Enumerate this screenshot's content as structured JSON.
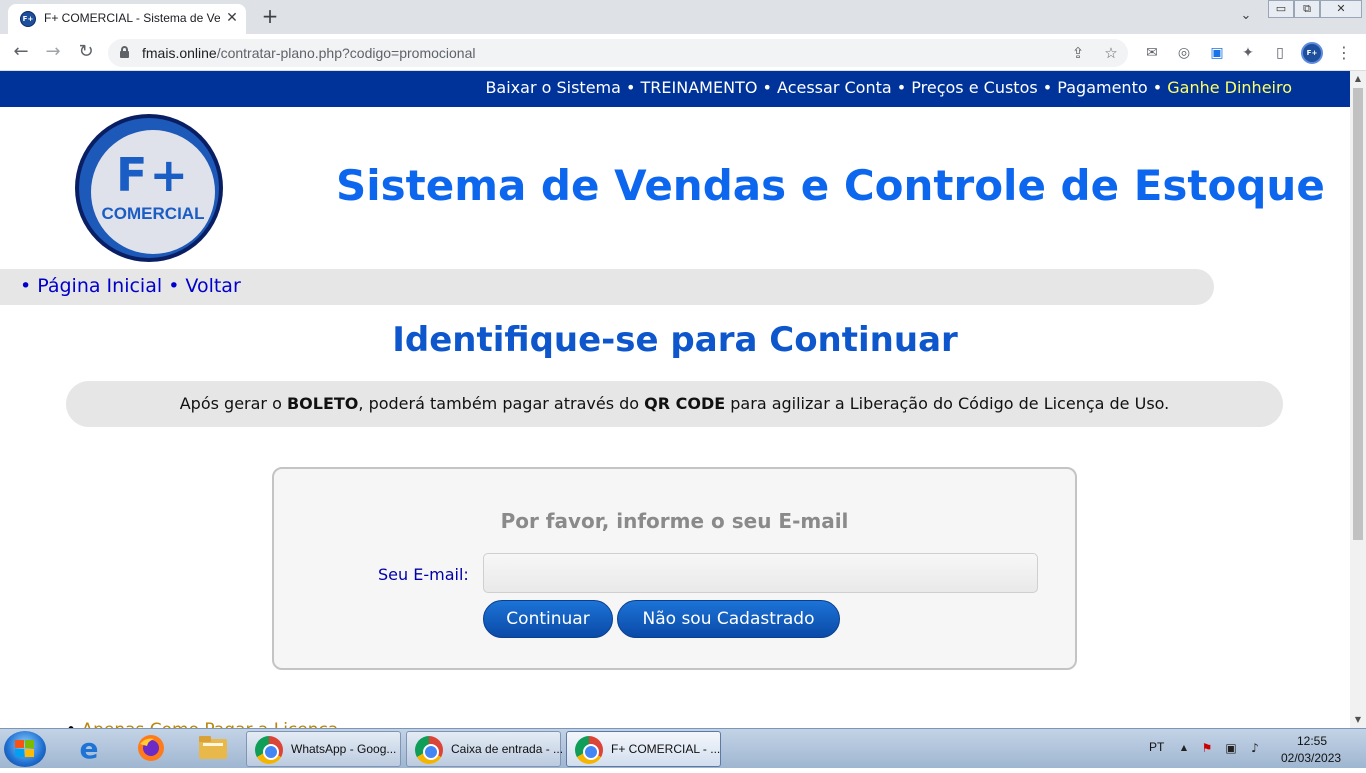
{
  "browser": {
    "tab_title": "F+ COMERCIAL - Sistema de Ven",
    "tab_close": "✕",
    "new_tab": "+",
    "tab_search": "⌄",
    "window_controls": [
      "▭",
      "⧉",
      "✕"
    ],
    "url_domain": "fmais.online",
    "url_path": "/contratar-plano.php?codigo=promocional",
    "nav": {
      "back": "←",
      "forward": "→",
      "reload": "↻"
    },
    "omnibox_icons": {
      "share": "⇪",
      "bookmark": "☆"
    },
    "extensions": [
      "✉",
      "◎",
      "▣",
      "✦",
      "▯"
    ],
    "profile_label": "F+",
    "menu": "⋮"
  },
  "site": {
    "topnav": {
      "links": [
        "Baixar o Sistema",
        "TREINAMENTO",
        "Acessar Conta",
        "Preços e Custos",
        "Pagamento"
      ],
      "highlight_link": "Ganhe Dinheiro",
      "separator": " • ",
      "highlight_color": "#ffff66"
    },
    "logo": {
      "main": "F+",
      "sub": "COMERCIAL"
    },
    "title": "Sistema de Vendas e Controle de Estoque",
    "breadcrumbs": [
      "• Página Inicial",
      "• Voltar"
    ],
    "section_title": "Identifique-se para Continuar",
    "notice": {
      "part1": "Após gerar o ",
      "bold1": "BOLETO",
      "part2": ", poderá também pagar através do ",
      "bold2": "QR CODE",
      "part3": " para agilizar a Liberação do Código de Licença de Uso."
    },
    "login": {
      "title": "Por favor, informe o seu E-mail",
      "email_label": "Seu E-mail:",
      "email_value": "",
      "continue_button": "Continuar",
      "not_registered_button": "Não sou Cadastrado"
    },
    "below_list": {
      "bullet": "•",
      "item": "Apenas Como Pagar a Licença"
    }
  },
  "taskbar": {
    "tasks": [
      {
        "label": "WhatsApp - Goog..."
      },
      {
        "label": "Caixa de entrada - ..."
      },
      {
        "label": "F+ COMERCIAL - ..."
      }
    ],
    "language": "PT",
    "tray_arrow": "▲",
    "time": "12:55",
    "date": "02/03/2023"
  }
}
